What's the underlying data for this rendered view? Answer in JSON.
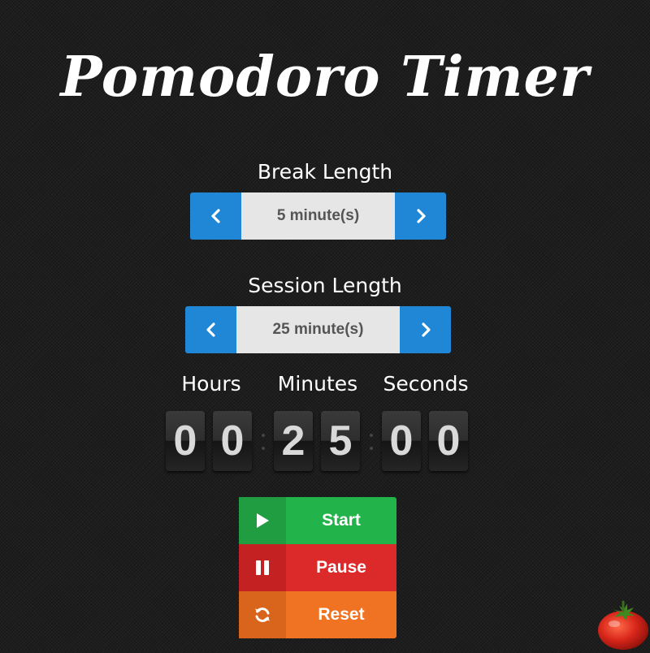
{
  "app": {
    "title": "Pomodoro Timer"
  },
  "break_length": {
    "label": "Break Length",
    "value_text": "5 minute(s)",
    "value": 5
  },
  "session_length": {
    "label": "Session Length",
    "value_text": "25 minute(s)",
    "value": 25
  },
  "clock": {
    "labels": {
      "hours": "Hours",
      "minutes": "Minutes",
      "seconds": "Seconds"
    },
    "digits": {
      "h1": "0",
      "h2": "0",
      "m1": "2",
      "m2": "5",
      "s1": "0",
      "s2": "0"
    }
  },
  "controls": {
    "start": {
      "label": "Start",
      "icon": "play-icon"
    },
    "pause": {
      "label": "Pause",
      "icon": "pause-icon"
    },
    "reset": {
      "label": "Reset",
      "icon": "refresh-icon"
    }
  },
  "decoration": {
    "icon": "tomato-icon"
  },
  "colors": {
    "background": "#1e1e1e",
    "stepper_arrow": "#2087d6",
    "stepper_value_bg": "#e6e6e6",
    "start": "#22b44a",
    "pause": "#dc2a2a",
    "reset": "#ef7323"
  }
}
